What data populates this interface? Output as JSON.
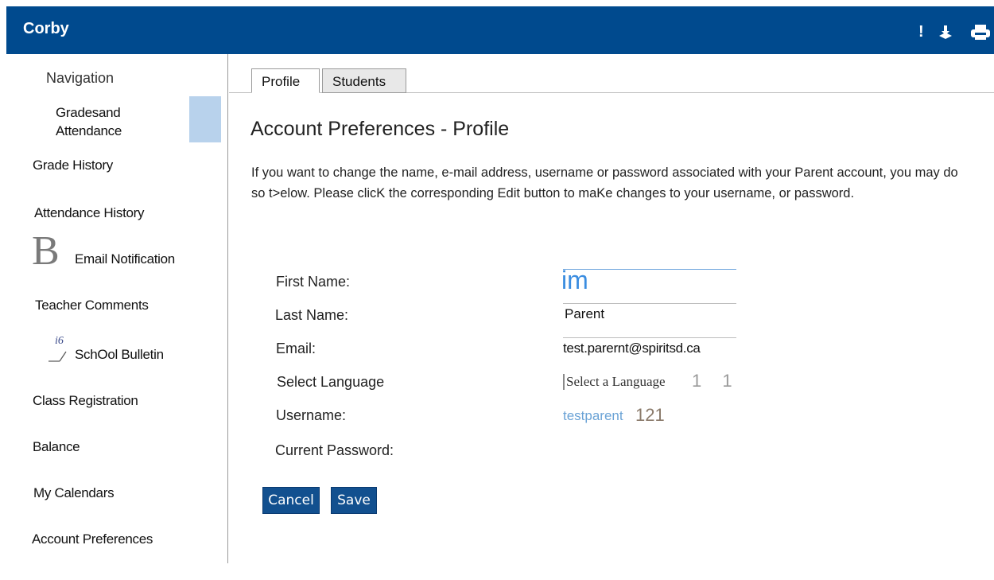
{
  "header": {
    "app_title": "Corby",
    "alert_icon": "!",
    "icons": [
      "alert-icon",
      "download-icon",
      "print-icon"
    ],
    "colors": {
      "background": "#004a8e",
      "text": "#ffffff"
    }
  },
  "sidebar": {
    "heading": "Navigation",
    "items": [
      {
        "name": "grades-attendance",
        "label": "Gradesand Attendance",
        "active": true
      },
      {
        "name": "grade-history",
        "label": "Grade History"
      },
      {
        "name": "attendance-history",
        "label": "Attendance History"
      },
      {
        "name": "email-notification",
        "label": "Email Notification"
      },
      {
        "name": "teacher-comments",
        "label": "Teacher Comments"
      },
      {
        "name": "school-bulletin",
        "label": "SchOol Bulletin"
      },
      {
        "name": "class-registration",
        "label": "Class Registration"
      },
      {
        "name": "balance",
        "label": "Balance"
      },
      {
        "name": "my-calendars",
        "label": "My Calendars"
      },
      {
        "name": "account-preferences",
        "label": "Account Preferences"
      }
    ],
    "email_glyph": "B",
    "bulletin_glyph": "i6",
    "active_color": "#b8d2ec"
  },
  "tabs": [
    {
      "label": "Profile",
      "selected": true
    },
    {
      "label": "Students",
      "selected": false
    }
  ],
  "main": {
    "title": "Account  Preferences - Profile",
    "intro": "If you want to change the name, e-mail address, username or password associated with your Parent account, you may do so t>elow. Please clicK the corresponding Edit button to maKe changes  to your username, or password.",
    "fields": {
      "first_name": {
        "label": "First Name:",
        "value": "im"
      },
      "last_name": {
        "label": "Last Name:",
        "value": "Parent"
      },
      "email": {
        "label": "Email:",
        "value": "test.parernt@spiritsd.ca"
      },
      "language": {
        "label": "Select Language",
        "value": "Select a Language",
        "suffix": "1  1"
      },
      "username": {
        "label": "Username:",
        "value": "testparent",
        "suffix": "121"
      },
      "current_password": {
        "label": "Current  Password:",
        "value": ""
      }
    },
    "buttons": {
      "cancel": "Cancel",
      "save": "Save"
    },
    "accent_color": "#12508f"
  }
}
